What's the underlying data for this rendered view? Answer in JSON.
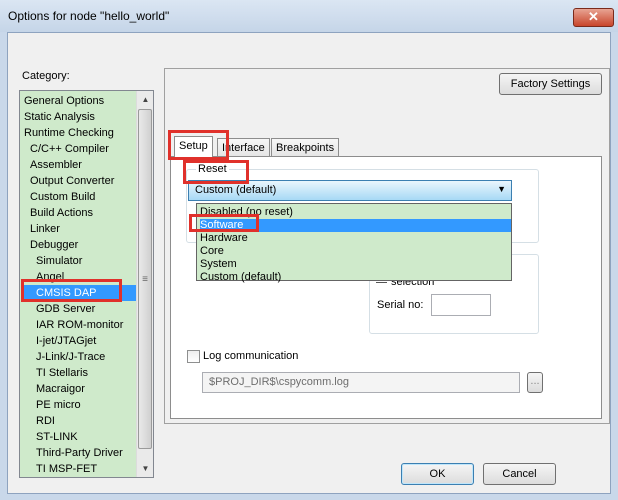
{
  "window": {
    "title": "Options for node \"hello_world\"",
    "close_glyph": "✕"
  },
  "category": {
    "label": "Category:",
    "items": [
      "General Options",
      "Static Analysis",
      "Runtime Checking",
      "C/C++ Compiler",
      "Assembler",
      "Output Converter",
      "Custom Build",
      "Build Actions",
      "Linker",
      "Debugger",
      "Simulator",
      "Angel",
      "CMSIS DAP",
      "GDB Server",
      "IAR ROM-monitor",
      "I-jet/JTAGjet",
      "J-Link/J-Trace",
      "TI Stellaris",
      "Macraigor",
      "PE micro",
      "RDI",
      "ST-LINK",
      "Third-Party Driver",
      "TI MSP-FET"
    ],
    "selected": "CMSIS DAP",
    "scroll_up_glyph": "▲",
    "scroll_down_glyph": "▼",
    "thumb_grip_glyph": "≡"
  },
  "factory_settings_label": "Factory Settings",
  "tabs": [
    "Setup",
    "Interface",
    "Breakpoints"
  ],
  "active_tab": "Setup",
  "reset": {
    "label": "Reset",
    "value": "Custom (default)",
    "arrow_glyph": "▼",
    "options": [
      "Disabled (no reset)",
      "Software",
      "Hardware",
      "Core",
      "System",
      "Custom (default)"
    ],
    "highlighted": "Software"
  },
  "selection_label": "selection",
  "serial_no_label": "Serial no:",
  "serial_no_value": "",
  "log": {
    "label": "Log communication",
    "checked": false,
    "path": "$PROJ_DIR$\\cspycomm.log",
    "browse_label": "..."
  },
  "ok_label": "OK",
  "cancel_label": "Cancel",
  "highlight_color": "#e0312b",
  "selection_color": "#3399ff",
  "list_bg_color": "#cfeacb"
}
